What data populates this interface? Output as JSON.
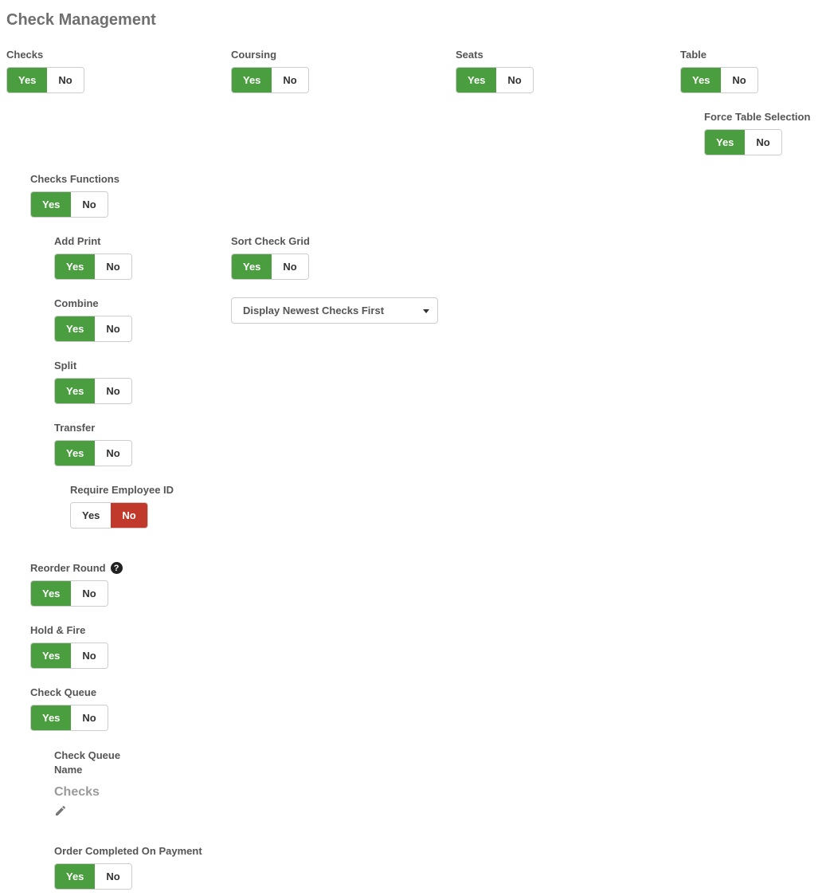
{
  "page_title": "Check Management",
  "yes": "Yes",
  "no": "No",
  "labels": {
    "checks": "Checks",
    "coursing": "Coursing",
    "seats": "Seats",
    "table": "Table",
    "checks_functions": "Checks Functions",
    "force_table_selection": "Force Table Selection",
    "add_print": "Add Print",
    "sort_check_grid": "Sort Check Grid",
    "combine": "Combine",
    "split": "Split",
    "transfer": "Transfer",
    "require_employee_id": "Require Employee ID",
    "reorder_round": "Reorder Round",
    "hold_fire": "Hold & Fire",
    "check_queue": "Check Queue",
    "check_queue_name": "Check Queue Name",
    "order_completed_on_payment": "Order Completed On Payment"
  },
  "sort_dropdown": {
    "selected": "Display Newest Checks First"
  },
  "check_queue_name_value": "Checks",
  "states": {
    "checks": "yes",
    "coursing": "yes",
    "seats": "yes",
    "table": "yes",
    "checks_functions": "yes",
    "force_table_selection": "yes",
    "add_print": "yes",
    "sort_check_grid": "yes",
    "combine": "yes",
    "split": "yes",
    "transfer": "yes",
    "require_employee_id": "no",
    "reorder_round": "yes",
    "hold_fire": "yes",
    "check_queue": "yes",
    "order_completed_on_payment": "yes"
  }
}
